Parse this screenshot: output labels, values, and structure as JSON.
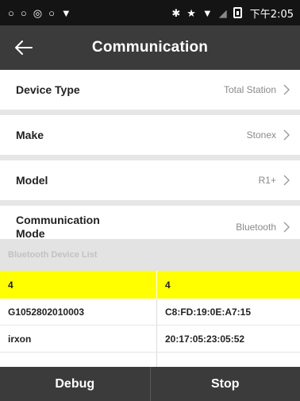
{
  "status_bar": {
    "left_icons": [
      "○",
      "○",
      "◎",
      "○",
      "▼"
    ],
    "right_icons": [
      "✱",
      "★",
      "▼",
      "◢"
    ],
    "time": "下午2:05"
  },
  "app_bar": {
    "title": "Communication",
    "back_icon": "arrow-left-icon"
  },
  "settings": [
    {
      "label": "Device Type",
      "value": "Total Station"
    },
    {
      "label": "Make",
      "value": "Stonex"
    },
    {
      "label": "Model",
      "value": "R1+"
    },
    {
      "label": "Communication Mode",
      "value": "Bluetooth"
    }
  ],
  "device_list": {
    "header": "Bluetooth Device List",
    "rows": [
      {
        "name": "4",
        "address": "4",
        "selected": true
      },
      {
        "name": "G1052802010003",
        "address": "C8:FD:19:0E:A7:15",
        "selected": false
      },
      {
        "name": "irxon",
        "address": "20:17:05:23:05:52",
        "selected": false
      }
    ]
  },
  "bottom_bar": {
    "debug_label": "Debug",
    "stop_label": "Stop"
  },
  "colors": {
    "toolbar": "#3b3b3b",
    "status_bar": "#141414",
    "selected_row": "#ffff00",
    "separator": "#e6e6e6",
    "section_header": "#e3e3e3"
  }
}
